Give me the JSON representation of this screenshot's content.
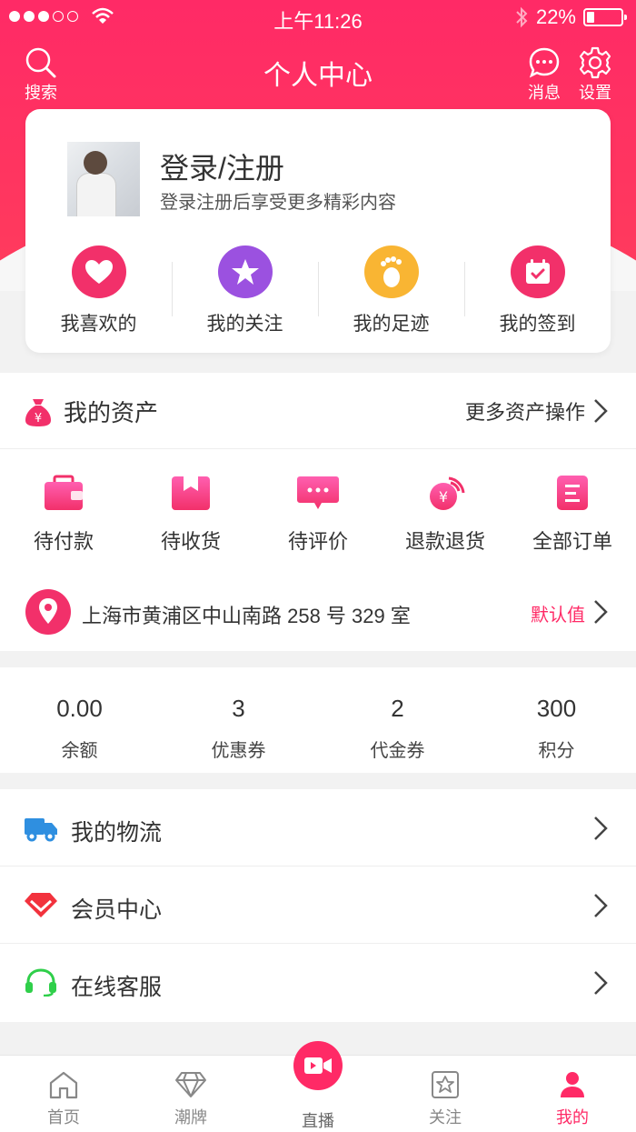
{
  "status_bar": {
    "time": "上午11:26",
    "battery": "22%",
    "battery_level": 0.22
  },
  "header": {
    "title": "个人中心",
    "search_label": "搜索",
    "messages_label": "消息",
    "settings_label": "设置"
  },
  "profile": {
    "name": "登录/注册",
    "subtitle": "登录注册后享受更多精彩内容",
    "quick_links": [
      {
        "label": "我喜欢的",
        "icon": "heart-icon",
        "color": "#f2306a"
      },
      {
        "label": "我的关注",
        "icon": "star-icon",
        "color": "#9b51e0"
      },
      {
        "label": "我的足迹",
        "icon": "footprint-icon",
        "color": "#f9b533"
      },
      {
        "label": "我的签到",
        "icon": "calendar-check-icon",
        "color": "#f2306a"
      }
    ]
  },
  "assets": {
    "title": "我的资产",
    "more": "更多资产操作"
  },
  "orders": [
    {
      "label": "待付款",
      "icon": "wallet-icon"
    },
    {
      "label": "待收货",
      "icon": "package-icon"
    },
    {
      "label": "待评价",
      "icon": "comment-icon"
    },
    {
      "label": "退款退货",
      "icon": "refund-icon"
    },
    {
      "label": "全部订单",
      "icon": "order-list-icon"
    }
  ],
  "address": {
    "text": "上海市黄浦区中山南路 258 号 329 室",
    "default_label": "默认值"
  },
  "stats": [
    {
      "value": "0.00",
      "label": "余额"
    },
    {
      "value": "3",
      "label": "优惠券"
    },
    {
      "value": "2",
      "label": "代金券"
    },
    {
      "value": "300",
      "label": "积分"
    }
  ],
  "menu": [
    {
      "label": "我的物流",
      "icon": "truck-icon",
      "color": "#2f8fe0"
    },
    {
      "label": "会员中心",
      "icon": "diamond-icon",
      "color": "#f2323d"
    },
    {
      "label": "在线客服",
      "icon": "headset-icon",
      "color": "#2fcf4a"
    }
  ],
  "tabs": [
    {
      "label": "首页",
      "icon": "home-icon"
    },
    {
      "label": "潮牌",
      "icon": "diamond-outline-icon"
    },
    {
      "label": "直播",
      "icon": "video-icon"
    },
    {
      "label": "关注",
      "icon": "star-box-icon"
    },
    {
      "label": "我的",
      "icon": "user-icon",
      "active": true
    }
  ],
  "colors": {
    "accent": "#ff2a66",
    "background": "#f2f2f2"
  }
}
